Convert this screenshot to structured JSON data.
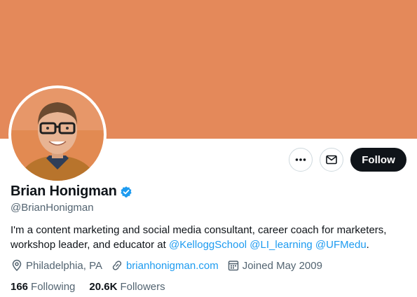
{
  "profile": {
    "name": "Brian Honigman",
    "handle": "@BrianHonigman",
    "verified": true,
    "bio_text_1": "I'm a content marketing and social media consultant, career coach for marketers, workshop leader, and educator at ",
    "bio_mentions": [
      "@KelloggSchool",
      "@LI_learning",
      "@UFMedu"
    ],
    "bio_end": "."
  },
  "meta": {
    "location": "Philadelphia, PA",
    "website": "brianhonigman.com",
    "joined": "Joined May 2009"
  },
  "stats": {
    "following_count": "166",
    "following_label": "Following",
    "followers_count": "20.6K",
    "followers_label": "Followers"
  },
  "actions": {
    "follow_label": "Follow"
  },
  "icons": {
    "more": "more-horizontal-icon",
    "message": "mail-icon",
    "location": "location-pin-icon",
    "link": "link-icon",
    "calendar": "calendar-icon",
    "verified": "verified-badge-icon"
  },
  "colors": {
    "banner": "#e4895a",
    "accent": "#1d9bf0",
    "text": "#0f1419",
    "muted": "#536471"
  }
}
